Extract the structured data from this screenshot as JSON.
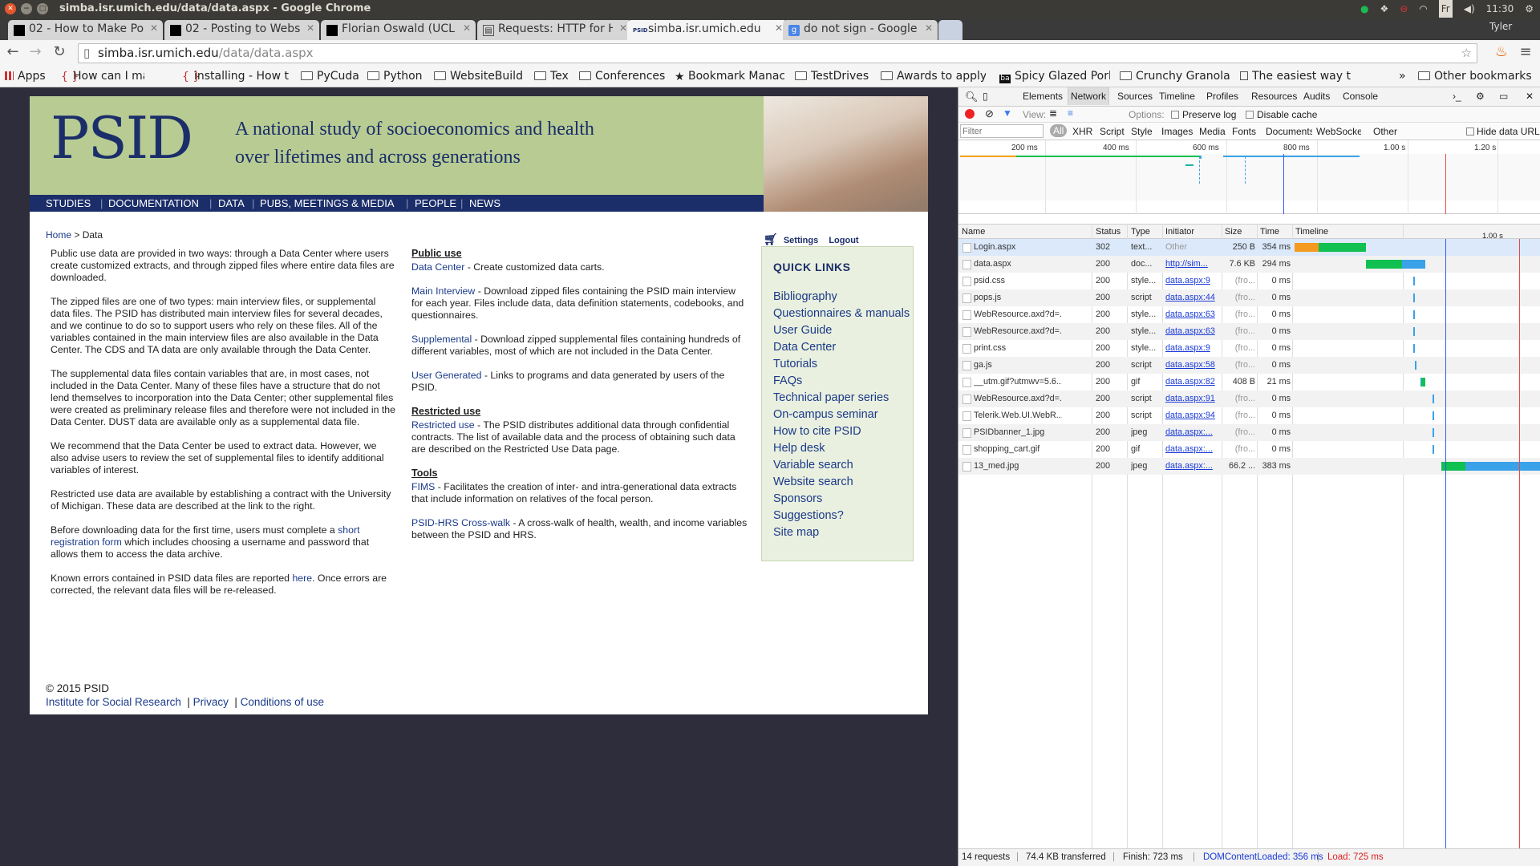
{
  "window": {
    "title": "simba.isr.umich.edu/data/data.aspx - Google Chrome",
    "time": "11:30",
    "user": "Tyler",
    "keyboard": "Fr"
  },
  "tabs": [
    {
      "label": "02 - How to Make Po",
      "icon": "black-square-icon"
    },
    {
      "label": "02 - Posting to Webs",
      "icon": "black-square-icon"
    },
    {
      "label": "Florian Oswald (UCL",
      "icon": "black-square-icon"
    },
    {
      "label": "Requests: HTTP for H",
      "icon": "document-icon"
    },
    {
      "label": "simba.isr.umich.edu",
      "icon": "psid-icon"
    },
    {
      "label": "do not sign - Google",
      "icon": "google-icon"
    }
  ],
  "toolbar": {
    "url_host": "simba.isr.umich.edu",
    "url_path": "/data/data.aspx"
  },
  "bookmarks": [
    {
      "label": "Apps",
      "icon": "apps-icon"
    },
    {
      "label": "How can I manua",
      "icon": "stackoverflow-icon"
    },
    {
      "label": "installing - How t",
      "icon": "stackoverflow-icon"
    },
    {
      "label": "PyCuda",
      "icon": "folder-icon"
    },
    {
      "label": "Python",
      "icon": "folder-icon"
    },
    {
      "label": "WebsiteBuild",
      "icon": "folder-icon"
    },
    {
      "label": "Tex",
      "icon": "folder-icon"
    },
    {
      "label": "Conferences",
      "icon": "folder-icon"
    },
    {
      "label": "Bookmark Manac",
      "icon": "star-icon"
    },
    {
      "label": "TestDrives",
      "icon": "folder-icon"
    },
    {
      "label": "Awards to apply t",
      "icon": "folder-icon"
    },
    {
      "label": "Spicy Glazed Pork",
      "icon": "ba-icon"
    },
    {
      "label": "Crunchy Granola",
      "icon": "folder-icon"
    },
    {
      "label": "The easiest way t",
      "icon": "document-icon"
    },
    {
      "label": "»",
      "icon": ""
    },
    {
      "label": "Other bookmarks",
      "icon": "folder-icon"
    }
  ],
  "site": {
    "logo": "PSID",
    "tagline1": "A national study of socioeconomics and health",
    "tagline2": "over lifetimes and across generations",
    "menu": [
      "STUDIES",
      "DOCUMENTATION",
      "DATA",
      "PUBS, MEETINGS & MEDIA",
      "PEOPLE",
      "NEWS"
    ],
    "breadcrumb_home": "Home",
    "breadcrumb_current": "> Data",
    "settings": "Settings",
    "logout": "Logout",
    "col1": [
      "Public use data are provided in two ways: through a Data Center where users create customized extracts, and through zipped files where entire data files are downloaded.",
      "The zipped files are one of two types: main interview files, or supplemental data files. The PSID has distributed main interview files for several decades, and we continue to do so to support users who rely on these files. All of the variables contained in the main interview files are also available in the Data Center. The CDS and TA data are only available through the Data Center.",
      "The supplemental data files contain variables that are, in most cases, not included in the Data Center. Many of these files have a structure that do not lend themselves to incorporation into the Data Center; other supplemental files were created as preliminary release files and therefore were not included in the Data Center. DUST data are available only as a supplemental data file.",
      "We recommend that the Data Center be used to extract data. However, we also advise users to review the set of supplemental files to identify additional variables of interest.",
      "Restricted use data are available by establishing a contract with the University of Michigan. These data are described at the link to the right."
    ],
    "col1_reg_pre": "Before downloading data for the first time, users must complete a ",
    "col1_reg_link": "short registration form",
    "col1_reg_post": " which includes choosing a username and password that allows them to access the data archive.",
    "col1_err_pre": "Known errors contained in PSID data files are reported ",
    "col1_err_link": "here",
    "col1_err_post": ". Once errors are corrected, the relevant data files will be re-released.",
    "public_use_heading": "Public use",
    "data_center_link": "Data Center",
    "data_center_text": " - Create customized data carts.",
    "main_interview_link": "Main Interview",
    "main_interview_text": " - Download zipped files containing the PSID main interview for each year. Files include data, data definition statements, codebooks, and questionnaires.",
    "supplemental_link": "Supplemental",
    "supplemental_text": " - Download zipped supplemental files containing hundreds of different variables, most of which are not included in the Data Center.",
    "user_generated_link": "User Generated",
    "user_generated_text": " - Links to programs and data generated by users of the PSID.",
    "restricted_heading": "Restricted use",
    "restricted_link": "Restricted use",
    "restricted_text": " - The PSID distributes additional data through confidential contracts. The list of available data and the process of obtaining such data are described on the Restricted Use Data page.",
    "tools_heading": "Tools",
    "fims_link": "FIMS",
    "fims_text": " - Facilitates the creation of inter- and intra-generational data extracts that include information on relatives of the focal person.",
    "crosswalk_link": "PSID-HRS Cross-walk",
    "crosswalk_text": " -  A cross-walk of health, wealth, and income variables between the PSID and HRS.",
    "quick_links_title": "QUICK LINKS",
    "quick_links": [
      "Bibliography",
      "Questionnaires & manuals",
      "User Guide",
      "Data Center",
      "Tutorials",
      "FAQs",
      "Technical paper series",
      "On-campus seminar",
      "How to cite PSID",
      "Help desk",
      "Variable search",
      "Website search",
      "Sponsors",
      "Suggestions?",
      "Site map"
    ],
    "copyright": "© 2015 PSID",
    "footer_links": [
      "Institute for Social Research",
      "Privacy",
      "Conditions of use"
    ]
  },
  "devtools": {
    "tabs": [
      "Elements",
      "Network",
      "Sources",
      "Timeline",
      "Profiles",
      "Resources",
      "Audits",
      "Console"
    ],
    "active_tab": "Network",
    "view_label": "View:",
    "options_label": "Options:",
    "preserve_log": "Preserve log",
    "disable_cache": "Disable cache",
    "filter_placeholder": "Filter",
    "filter_types": [
      "All",
      "XHR",
      "Script",
      "Style",
      "Images",
      "Media",
      "Fonts",
      "Documents",
      "WebSockets",
      "Other"
    ],
    "hide_data_urls": "Hide data URLs",
    "overview_ticks": [
      "200 ms",
      "400 ms",
      "600 ms",
      "800 ms",
      "1.00 s",
      "1.20 s"
    ],
    "columns": [
      "Name",
      "Status",
      "Type",
      "Initiator",
      "Size",
      "Time",
      "Timeline"
    ],
    "timeline_tick": "1.00 s",
    "requests": [
      {
        "name": "Login.aspx",
        "status": "302",
        "type": "text...",
        "initiator": "Other",
        "size": "250 B",
        "time": "354 ms"
      },
      {
        "name": "data.aspx",
        "status": "200",
        "type": "doc...",
        "initiator": "http://sim...",
        "size": "7.6 KB",
        "time": "294 ms"
      },
      {
        "name": "psid.css",
        "status": "200",
        "type": "style...",
        "initiator": "data.aspx:9",
        "size": "(fro...",
        "time": "0 ms"
      },
      {
        "name": "pops.js",
        "status": "200",
        "type": "script",
        "initiator": "data.aspx:44",
        "size": "(fro...",
        "time": "0 ms"
      },
      {
        "name": "WebResource.axd?d=...",
        "status": "200",
        "type": "style...",
        "initiator": "data.aspx:63",
        "size": "(fro...",
        "time": "0 ms"
      },
      {
        "name": "WebResource.axd?d=...",
        "status": "200",
        "type": "style...",
        "initiator": "data.aspx:63",
        "size": "(fro...",
        "time": "0 ms"
      },
      {
        "name": "print.css",
        "status": "200",
        "type": "style...",
        "initiator": "data.aspx:9",
        "size": "(fro...",
        "time": "0 ms"
      },
      {
        "name": "ga.js",
        "status": "200",
        "type": "script",
        "initiator": "data.aspx:58",
        "size": "(fro...",
        "time": "0 ms"
      },
      {
        "name": "__utm.gif?utmwv=5.6....",
        "status": "200",
        "type": "gif",
        "initiator": "data.aspx:82",
        "size": "408 B",
        "time": "21 ms"
      },
      {
        "name": "WebResource.axd?d=...",
        "status": "200",
        "type": "script",
        "initiator": "data.aspx:91",
        "size": "(fro...",
        "time": "0 ms"
      },
      {
        "name": "Telerik.Web.UI.WebR...",
        "status": "200",
        "type": "script",
        "initiator": "data.aspx:94",
        "size": "(fro...",
        "time": "0 ms"
      },
      {
        "name": "PSIDbanner_1.jpg",
        "status": "200",
        "type": "jpeg",
        "initiator": "data.aspx:...",
        "size": "(fro...",
        "time": "0 ms"
      },
      {
        "name": "shopping_cart.gif",
        "status": "200",
        "type": "gif",
        "initiator": "data.aspx:...",
        "size": "(fro...",
        "time": "0 ms"
      },
      {
        "name": "13_med.jpg",
        "status": "200",
        "type": "jpeg",
        "initiator": "data.aspx:...",
        "size": "66.2 ...",
        "time": "383 ms"
      }
    ],
    "status": {
      "requests": "14 requests",
      "transferred": "74.4 KB transferred",
      "finish": "Finish: 723 ms",
      "dom": "DOMContentLoaded: 356 ms",
      "load": "Load: 725 ms"
    }
  }
}
